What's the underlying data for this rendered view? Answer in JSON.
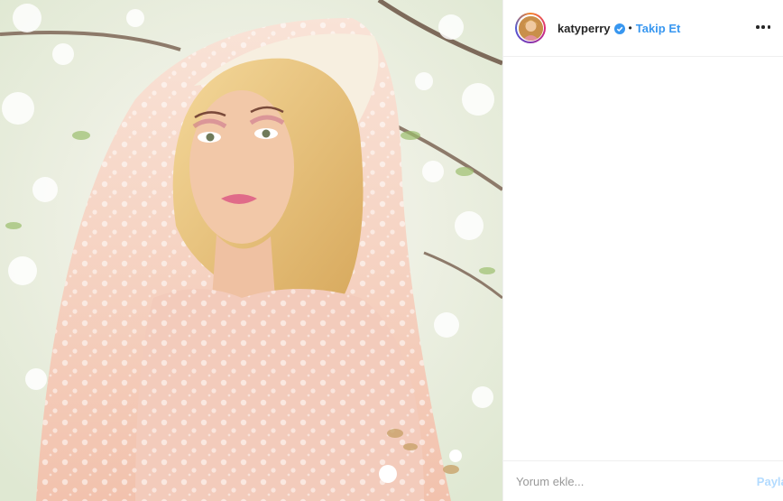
{
  "post": {
    "image_icon": "portrait-photo",
    "colors": {
      "lace": "#f6c9b8",
      "hair": "#e9c27a",
      "blossom": "#f7eef0",
      "leaf": "#9cbf6e"
    }
  },
  "header": {
    "username": "katyperry",
    "separator": "•",
    "follow_label": "Takip Et",
    "verified_icon": "verified-badge-icon",
    "more_icon": "more-options-icon"
  },
  "comment": {
    "placeholder": "Yorum ekle...",
    "value": "",
    "share_label": "Paylaş"
  },
  "colors": {
    "link": "#3897f0",
    "share_disabled": "#b3dbff",
    "text": "#262626",
    "border": "#efefef"
  }
}
